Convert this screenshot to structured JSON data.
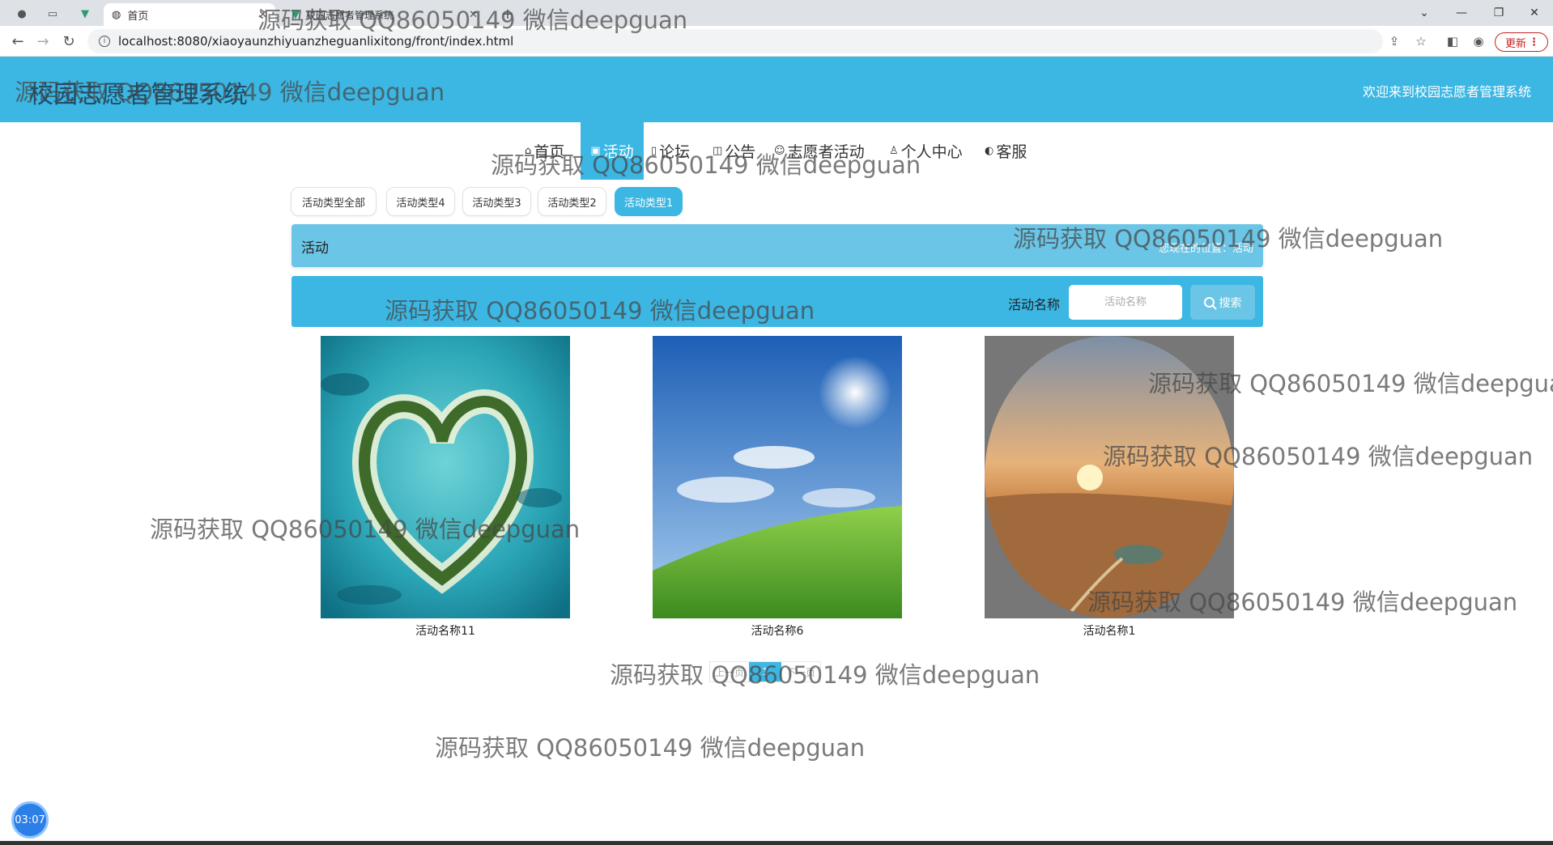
{
  "browser": {
    "tabs": [
      {
        "title": "首页",
        "active": true
      },
      {
        "title": "校园志愿者管理系统",
        "active": false
      }
    ],
    "url": "localhost:8080/xiaoyaunzhiyuanzheguanlixitong/front/index.html",
    "update_label": "更新"
  },
  "header": {
    "title": "校园志愿者管理系统",
    "welcome": "欢迎来到校园志愿者管理系统"
  },
  "nav": {
    "items": [
      {
        "label": "首页"
      },
      {
        "label": "活动"
      },
      {
        "label": "论坛"
      },
      {
        "label": "公告"
      },
      {
        "label": "志愿者活动"
      },
      {
        "label": "个人中心"
      },
      {
        "label": "客服"
      }
    ]
  },
  "categories": [
    {
      "label": "活动类型全部"
    },
    {
      "label": "活动类型4"
    },
    {
      "label": "活动类型3"
    },
    {
      "label": "活动类型2"
    },
    {
      "label": "活动类型1"
    }
  ],
  "breadcrumb": {
    "title": "活动",
    "location": "您现在的位置：活动"
  },
  "search": {
    "label": "活动名称",
    "placeholder": "活动名称",
    "button_label": "搜索"
  },
  "cards": [
    {
      "name": "活动名称11"
    },
    {
      "name": "活动名称6"
    },
    {
      "name": "活动名称1"
    }
  ],
  "pagination": {
    "prev": "上一页",
    "current": "1",
    "next": "下一页"
  },
  "watermark": "源码获取 QQ86050149 微信deepguan",
  "timer": "03:07",
  "colors": {
    "accent": "#3cb7e3",
    "accent_light": "#6ac5e6"
  }
}
